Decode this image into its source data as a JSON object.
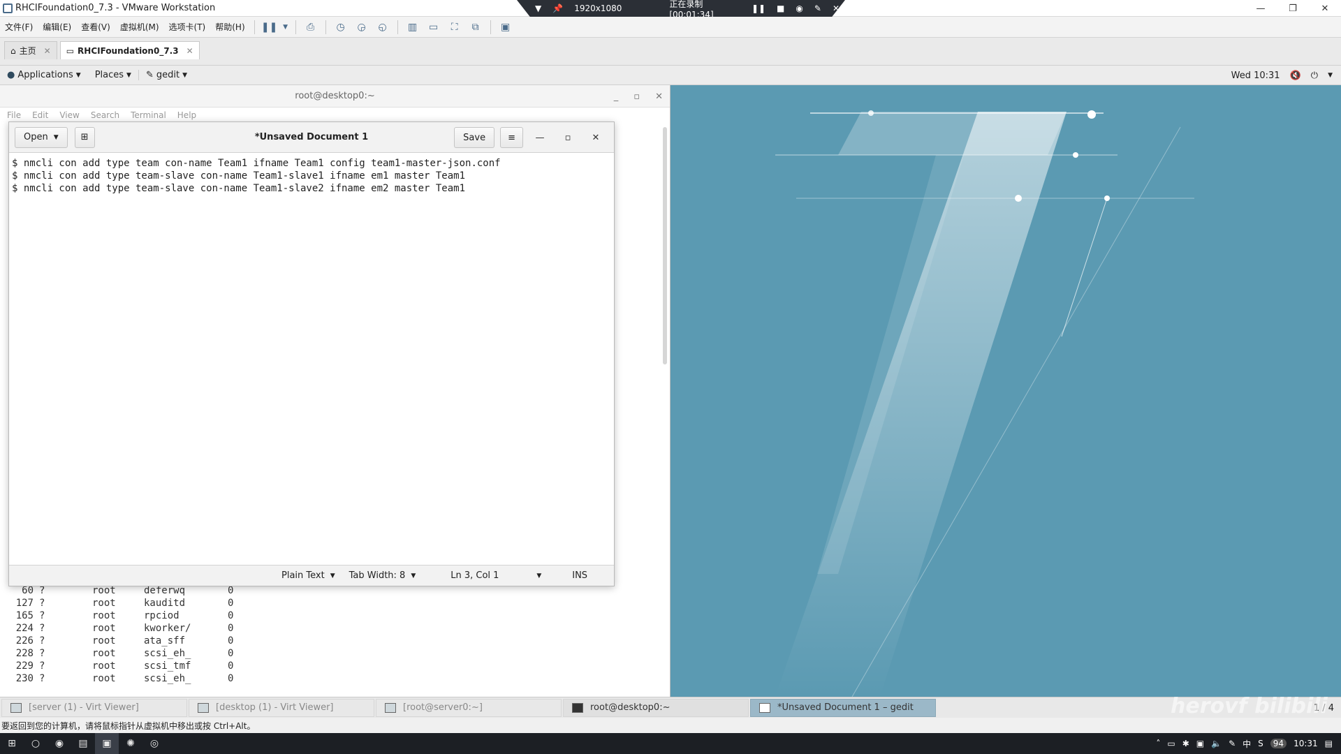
{
  "vmware": {
    "title": "RHCIFoundation0_7.3 - VMware Workstation",
    "recording": {
      "resolution": "1920x1080",
      "status": "正在录制 [00:01:34]"
    },
    "menu": [
      "文件(F)",
      "编辑(E)",
      "查看(V)",
      "虚拟机(M)",
      "选项卡(T)",
      "帮助(H)"
    ],
    "tabs": [
      {
        "label": "主页"
      },
      {
        "label": "RHCIFoundation0_7.3"
      }
    ],
    "status_line": "要返回到您的计算机，请将鼠标指针从虚拟机中移出或按 Ctrl+Alt。"
  },
  "gnome": {
    "applications": "Applications",
    "places": "Places",
    "app": "gedit",
    "clock": "Wed 10:31"
  },
  "terminal": {
    "title": "root@desktop0:~",
    "menu": [
      "File",
      "Edit",
      "View",
      "Search",
      "Terminal",
      "Help"
    ],
    "rows": [
      [
        "60",
        "?",
        "root",
        "deferwq",
        "0"
      ],
      [
        "127",
        "?",
        "root",
        "kauditd",
        "0"
      ],
      [
        "165",
        "?",
        "root",
        "rpciod",
        "0"
      ],
      [
        "224",
        "?",
        "root",
        "kworker/",
        "0"
      ],
      [
        "226",
        "?",
        "root",
        "ata_sff",
        "0"
      ],
      [
        "228",
        "?",
        "root",
        "scsi_eh_",
        "0"
      ],
      [
        "229",
        "?",
        "root",
        "scsi_tmf",
        "0"
      ],
      [
        "230",
        "?",
        "root",
        "scsi_eh_",
        "0"
      ]
    ]
  },
  "gedit": {
    "open_label": "Open",
    "title": "*Unsaved Document 1",
    "save_label": "Save",
    "lines": [
      "$ nmcli con add type team con-name Team1 ifname Team1 config team1-master-json.conf",
      "$ nmcli con add type team-slave con-name Team1-slave1 ifname em1 master Team1",
      "$ nmcli con add type team-slave con-name Team1-slave2 ifname em2 master Team1"
    ],
    "status": {
      "language": "Plain Text",
      "tab_width": "Tab Width: 8",
      "position": "Ln 3, Col 1",
      "mode": "INS"
    }
  },
  "vm_taskbar": {
    "items": [
      "[server (1) - Virt Viewer]",
      "[desktop (1) - Virt Viewer]",
      "[root@server0:~]",
      "root@desktop0:~",
      "*Unsaved Document 1 – gedit"
    ],
    "pager": "1 / 4"
  },
  "windows": {
    "clock": "10:31",
    "ime": "中",
    "badge": "94"
  },
  "watermark": "herovf bilibili"
}
